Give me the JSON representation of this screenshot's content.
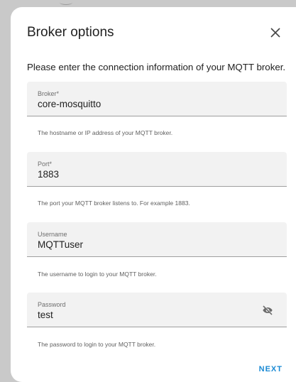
{
  "dialog": {
    "title": "Broker options",
    "intro": "Please enter the connection information of your MQTT broker.",
    "close_icon": "close-icon",
    "fields": [
      {
        "label": "Broker*",
        "value": "core-mosquitto",
        "helper": "The hostname or IP address of your MQTT broker."
      },
      {
        "label": "Port*",
        "value": "1883",
        "helper": "The port your MQTT broker listens to. For example 1883."
      },
      {
        "label": "Username",
        "value": "MQTTuser",
        "helper": "The username to login to your MQTT broker."
      },
      {
        "label": "Password",
        "value": "test",
        "helper": "The password to login to your MQTT broker.",
        "toggle_icon": "eye-off-icon"
      }
    ],
    "next_label": "NEXT",
    "accent_color": "#1a8ad4"
  }
}
